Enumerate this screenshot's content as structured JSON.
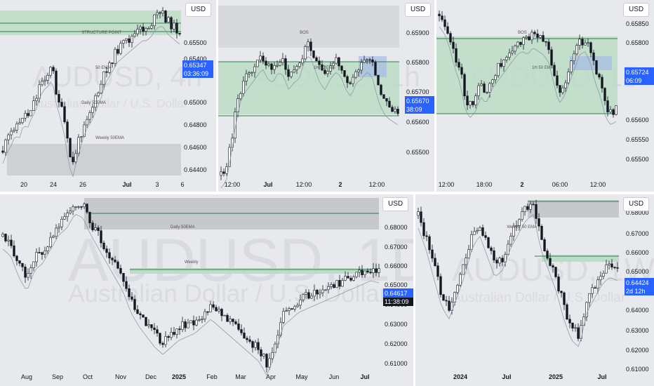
{
  "colors": {
    "up": "#ffffff",
    "down": "#131722",
    "bg": "#e8e9ec",
    "zone_green": "#b9dcc4",
    "zone_grey": "#c7c9ce",
    "line_green": "#2e7d4f",
    "ema": "#8891a7",
    "accent": "#2962ff"
  },
  "currency_label": "USD",
  "panels": [
    {
      "id": "p1",
      "watermark": "AUDUSD, 4h",
      "watermark_sub": "Australian Dollar / U.S. Dollar",
      "y_ticks": [
        "0.65500",
        "0.65400",
        "0.65347",
        "0.65000",
        "0.64800",
        "0.64600",
        "0.64400"
      ],
      "x_ticks": [
        "20",
        "24",
        "26",
        "Jul",
        "3",
        "6"
      ],
      "price_tag": "0.65347",
      "timer_tag": "03:36:09",
      "annotations": [
        "STRUCTURE POINT",
        "50 EMA",
        "Daily 50EMA",
        "Weekly 50EMA"
      ]
    },
    {
      "id": "p2",
      "watermark": "AUDUSD, 1h",
      "y_ticks": [
        "0.65900",
        "0.65800",
        "0.65700",
        "0.65670",
        "0.65600",
        "0.65500"
      ],
      "x_ticks": [
        "12:00",
        "Jul",
        "12:00",
        "2",
        "12:00"
      ],
      "price_tag": "0.65670",
      "timer_tag": "38:09",
      "annotations": [
        "BOS",
        "1H 50 EMA"
      ]
    },
    {
      "id": "p3",
      "watermark": "AUDUSD, 15",
      "y_ticks": [
        "0.65850",
        "0.65800",
        "0.65724",
        "0.65650",
        "0.65600",
        "0.65550",
        "0.65500"
      ],
      "x_ticks": [
        "12:00",
        "18:00",
        "2",
        "06:00",
        "12:00"
      ],
      "price_tag": "0.65724",
      "timer_tag": "06:09",
      "annotations": [
        "BOS",
        "1H 50 EMA"
      ]
    },
    {
      "id": "p4",
      "watermark": "AUDUSD, 1D",
      "watermark_sub": "Australian Dollar / U.S. Dollar",
      "y_ticks": [
        "0.68000",
        "0.67000",
        "0.66000",
        "0.65000",
        "0.64617",
        "0.64000",
        "0.63000",
        "0.62000",
        "0.61000"
      ],
      "x_ticks": [
        "Aug",
        "Sep",
        "Oct",
        "Nov",
        "Dec",
        "2025",
        "Feb",
        "Mar",
        "Apr",
        "May",
        "Jun",
        "Jul"
      ],
      "price_tag": "0.64617",
      "timer_tag": "11:38:09",
      "annotations": [
        "Daily 50EMA",
        "Weekly"
      ]
    },
    {
      "id": "p5",
      "watermark": "AUDUSD, 1W",
      "watermark_sub": "Australian Dollar / U.S. Dollar",
      "y_ticks": [
        "0.68000",
        "0.67000",
        "0.66000",
        "0.65000",
        "0.64424",
        "0.64000",
        "0.63000",
        "0.62000",
        "0.61000",
        "0.60000"
      ],
      "x_ticks": [
        "2024",
        "Jul",
        "2025",
        "Jul"
      ],
      "price_tag": "0.64424",
      "timer_tag": "2d 12h",
      "annotations": [
        "Weekly 50 EMA"
      ]
    }
  ]
}
